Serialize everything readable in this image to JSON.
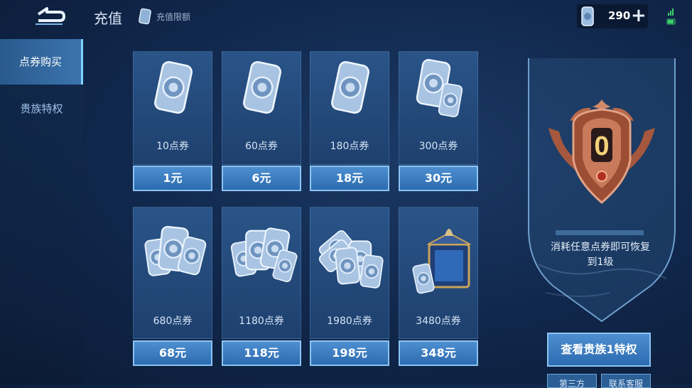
{
  "header": {
    "title": "充值",
    "limit_label": "充值限额",
    "currency_amount": "290",
    "plus_symbol": "+"
  },
  "sidebar": {
    "items": [
      {
        "label": "点券购买",
        "active": true
      },
      {
        "label": "贵族特权",
        "active": false
      }
    ]
  },
  "products": [
    {
      "label": "10点券",
      "price": "1元",
      "art": "single-voucher"
    },
    {
      "label": "60点券",
      "price": "6元",
      "art": "single-voucher"
    },
    {
      "label": "180点券",
      "price": "18元",
      "art": "single-voucher"
    },
    {
      "label": "300点券",
      "price": "30元",
      "art": "double-voucher"
    },
    {
      "label": "680点券",
      "price": "68元",
      "art": "triple-voucher"
    },
    {
      "label": "1180点券",
      "price": "118元",
      "art": "quad-voucher"
    },
    {
      "label": "1980点券",
      "price": "198元",
      "art": "stack-voucher"
    },
    {
      "label": "3480点券",
      "price": "348元",
      "art": "treasure-chest"
    }
  ],
  "vip": {
    "level": "0",
    "progress": 0,
    "description": "消耗任意点券即可恢复到1级",
    "view_button": "查看贵族1特权",
    "bottom_buttons": [
      "第三方",
      "联系客服"
    ]
  },
  "colors": {
    "accent": "#4d8fd0",
    "badge": "#b5603f"
  }
}
